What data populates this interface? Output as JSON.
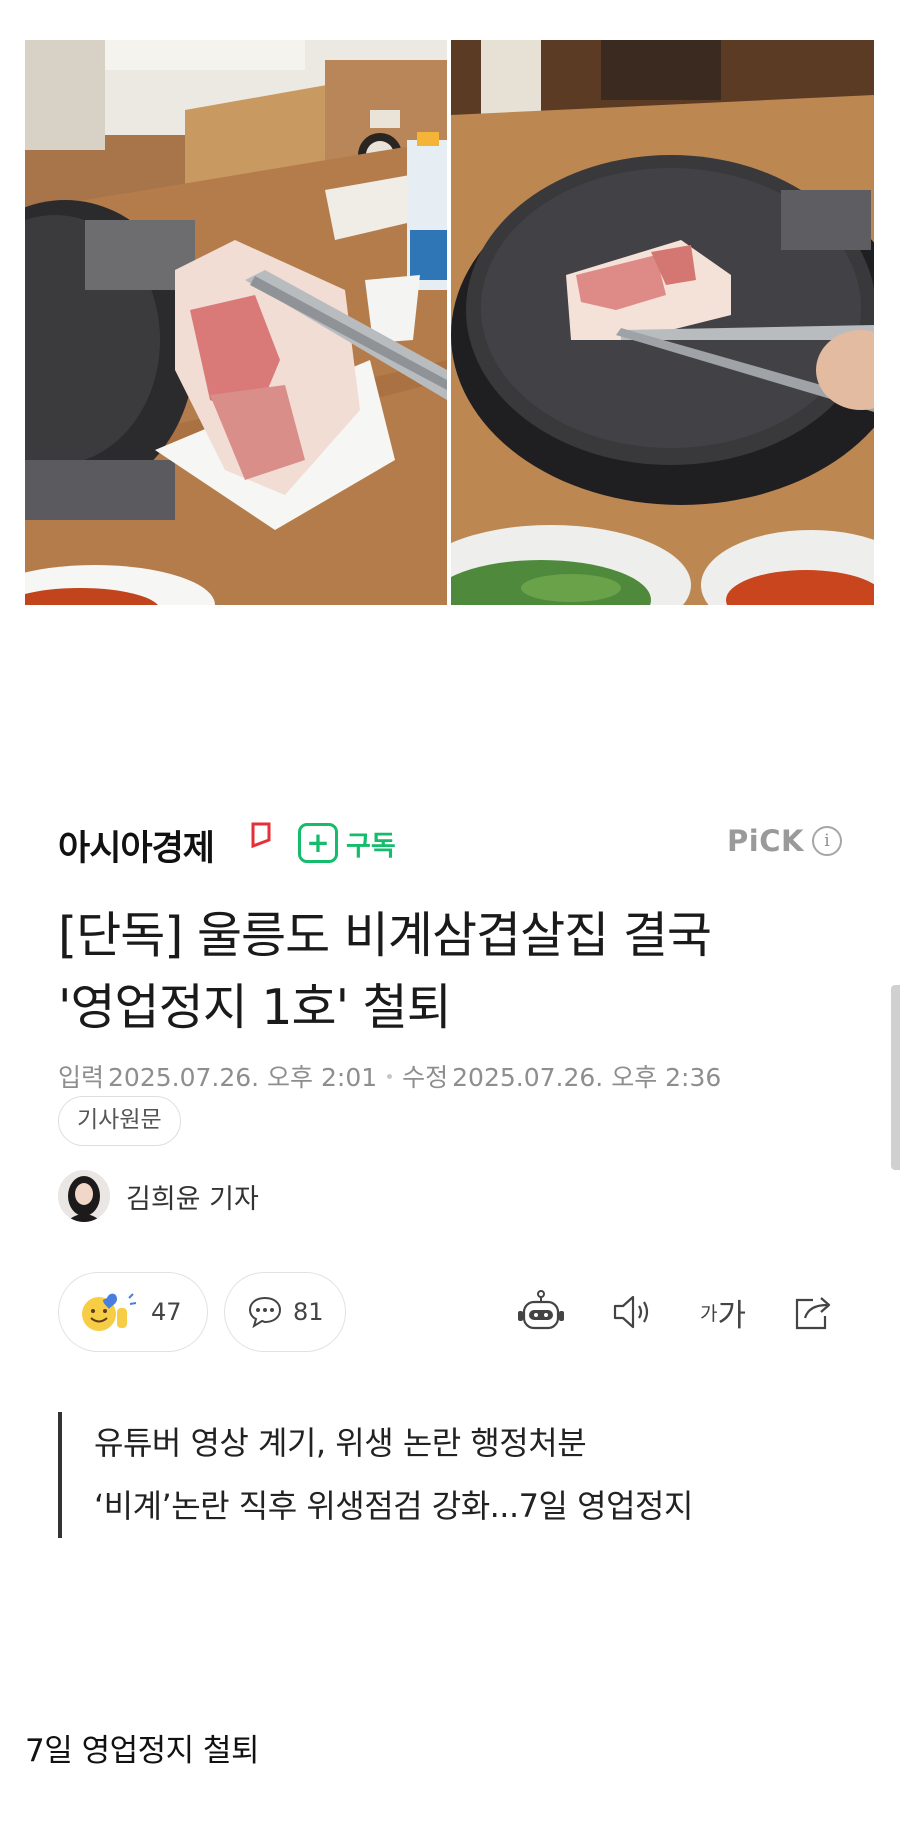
{
  "photos": {
    "left_alt": "",
    "right_alt": ""
  },
  "press": {
    "name": "아시아경제",
    "subscribe_label": "구독",
    "subscribe_symbol": "+",
    "pick_label": "PiCK",
    "pick_info_symbol": "i"
  },
  "article": {
    "headline_line1": "[단독] 울릉도 비계삼겹살집 결국",
    "headline_line2": "'영업정지 1호' 철퇴",
    "published_label": "입력",
    "published_date": "2025.07.26. 오후 2:01",
    "modified_label": "수정",
    "modified_date": "2025.07.26. 오후 2:36",
    "original_button": "기사원문",
    "reporter": "김희윤 기자"
  },
  "actions": {
    "reaction_count": "47",
    "comment_count": "81",
    "font_small": "가",
    "font_big": "가"
  },
  "summary": {
    "line1": "유튜버 영상 계기, 위생 논란 행정처분",
    "line2": "‘비계’논란 직후 위생점검 강화...7일 영업정지"
  },
  "caption": "7일 영업정지 철퇴",
  "colors": {
    "accent_green": "#14bc6b",
    "press_mark_red": "#e5303a",
    "muted_gray": "#8e8e8e"
  },
  "icons": [
    "plus-icon",
    "info-icon",
    "reaction-emoji-icon",
    "comment-icon",
    "summary-bot-icon",
    "audio-icon",
    "share-icon"
  ]
}
